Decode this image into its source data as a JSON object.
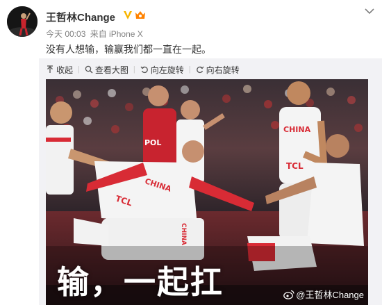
{
  "post": {
    "author": "王哲林Change",
    "timestamp": "今天 00:03",
    "source": "来自 iPhone X",
    "text": "没有人想输，输赢我们都一直在一起。"
  },
  "toolbar": {
    "collapse_label": "收起",
    "view_large_label": "查看大图",
    "rotate_left_label": "向左旋转",
    "rotate_right_label": "向右旋转"
  },
  "photo": {
    "caption": "输，一起扛",
    "watermark": "@王哲林Change",
    "jersey_china_1": "CHINA",
    "jersey_china_2": "CHINA",
    "jersey_china_3": "CHINA",
    "jersey_tcl_1": "TCL",
    "jersey_tcl_2": "TCL",
    "jersey_pol": "POL"
  },
  "colors": {
    "text_primary": "#333333",
    "text_meta": "#808080",
    "verified": "#f7b500",
    "panel_bg": "#f2f2f5",
    "china_red": "#d82b35"
  },
  "icons": [
    "chevron-down-icon",
    "verified-icon",
    "vip-icon",
    "collapse-icon",
    "zoom-icon",
    "rotate-left-icon",
    "rotate-right-icon",
    "weibo-logo-icon"
  ]
}
